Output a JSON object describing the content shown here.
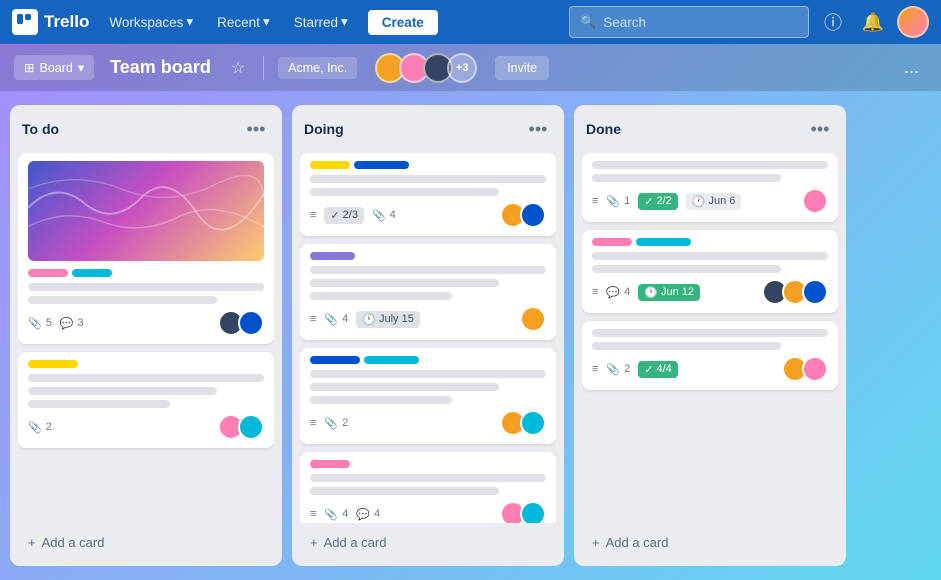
{
  "nav": {
    "logo_text": "Trello",
    "workspaces_label": "Workspaces",
    "recent_label": "Recent",
    "starred_label": "Starred",
    "create_label": "Create",
    "search_placeholder": "Search"
  },
  "board_header": {
    "board_menu_label": "Board",
    "board_title": "Team board",
    "workspace_name": "Acme, Inc.",
    "member_count_label": "+3",
    "invite_label": "Invite",
    "more_dots": "..."
  },
  "columns": [
    {
      "id": "todo",
      "title": "To do",
      "cards": [
        {
          "id": "card-1",
          "has_cover": true,
          "labels": [
            "pink",
            "cyan"
          ],
          "meta_attachment": "5",
          "meta_comment": "3",
          "has_avatars": true,
          "avatars": [
            "orange",
            "blue"
          ]
        },
        {
          "id": "card-2",
          "has_cover": false,
          "labels": [
            "yellow"
          ],
          "meta_attachment": "2",
          "meta_comment": null,
          "has_avatars": true,
          "avatars": [
            "pink",
            "teal"
          ]
        }
      ],
      "add_card_label": "+ Add a card"
    },
    {
      "id": "doing",
      "title": "Doing",
      "cards": [
        {
          "id": "card-3",
          "has_cover": false,
          "labels": [
            "yellow",
            "blue"
          ],
          "meta_checklist": "2/3",
          "meta_attachment": "4",
          "has_avatars": true,
          "avatars": [
            "orange",
            "blue"
          ]
        },
        {
          "id": "card-4",
          "has_cover": false,
          "labels": [
            "purple"
          ],
          "meta_attachment": "4",
          "meta_date": "July 15",
          "has_avatars": true,
          "avatars": [
            "orange"
          ]
        },
        {
          "id": "card-5",
          "has_cover": false,
          "labels": [
            "blue",
            "cyan"
          ],
          "meta_attachment": "2",
          "has_avatars": true,
          "avatars": [
            "orange",
            "teal"
          ]
        },
        {
          "id": "card-6",
          "has_cover": false,
          "labels": [
            "pink"
          ],
          "meta_attachment": "4",
          "meta_comment": "4",
          "has_avatars": true,
          "avatars": [
            "pink",
            "teal"
          ]
        }
      ],
      "add_card_label": "+ Add a card"
    },
    {
      "id": "done",
      "title": "Done",
      "cards": [
        {
          "id": "card-7",
          "has_cover": false,
          "labels": [],
          "meta_attachment": "1",
          "meta_checklist_badge": "2/2",
          "meta_date_badge": "Jun 6",
          "has_avatars": true,
          "avatars": [
            "pink"
          ]
        },
        {
          "id": "card-8",
          "has_cover": false,
          "labels": [
            "pink",
            "cyan"
          ],
          "meta_comment": "4",
          "meta_date_badge": "Jun 12",
          "has_avatars": true,
          "avatars": [
            "dark",
            "orange",
            "blue"
          ]
        },
        {
          "id": "card-9",
          "has_cover": false,
          "labels": [],
          "meta_attachment": "2",
          "meta_checklist_badge": "4/4",
          "has_avatars": true,
          "avatars": [
            "orange",
            "pink"
          ]
        }
      ],
      "add_card_label": "+ Add a card"
    }
  ]
}
